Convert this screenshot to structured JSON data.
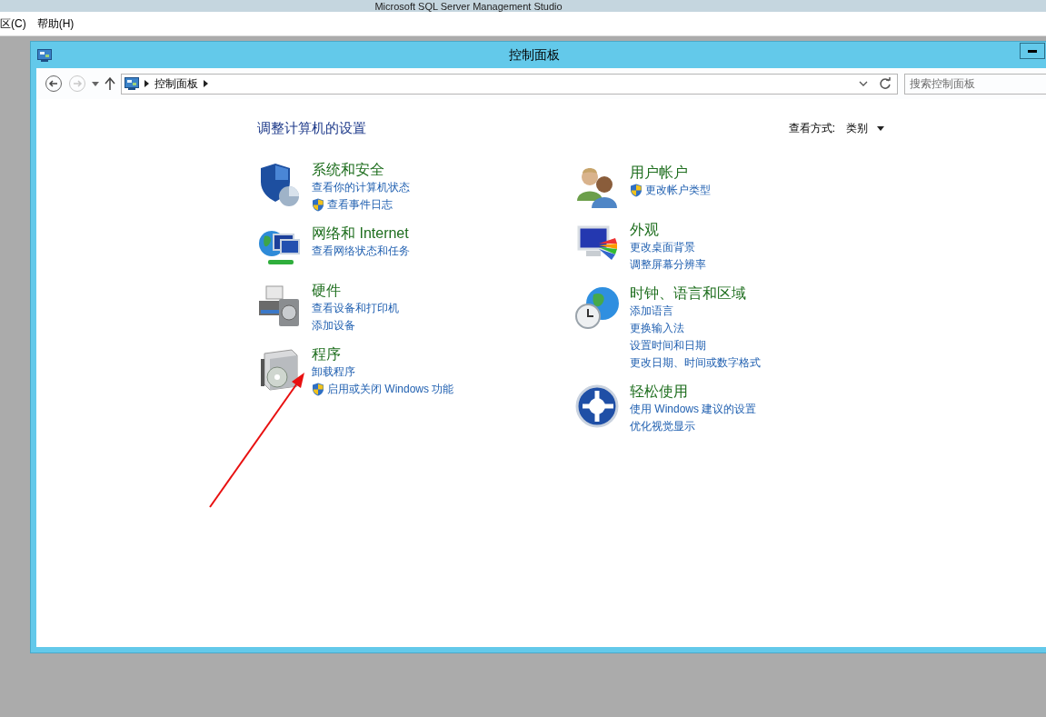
{
  "parent_window": {
    "title": "Microsoft SQL Server Management Studio",
    "menu": [
      "区(C)",
      "帮助(H)"
    ]
  },
  "window": {
    "title": "控制面板"
  },
  "address_bar": {
    "breadcrumb": [
      "控制面板"
    ],
    "search_placeholder": "搜索控制面板"
  },
  "heading": "调整计算机的设置",
  "view_by": {
    "label": "查看方式:",
    "value": "类别"
  },
  "columns": [
    [
      {
        "kind": "security",
        "title": "系统和安全",
        "links": [
          {
            "text": "查看你的计算机状态",
            "shield": false
          },
          {
            "text": "查看事件日志",
            "shield": true
          }
        ]
      },
      {
        "kind": "network",
        "title": "网络和 Internet",
        "links": [
          {
            "text": "查看网络状态和任务",
            "shield": false
          }
        ]
      },
      {
        "kind": "hardware",
        "title": "硬件",
        "links": [
          {
            "text": "查看设备和打印机",
            "shield": false
          },
          {
            "text": "添加设备",
            "shield": false
          }
        ]
      },
      {
        "kind": "programs",
        "title": "程序",
        "links": [
          {
            "text": "卸载程序",
            "shield": false
          },
          {
            "text": "启用或关闭 Windows 功能",
            "shield": true
          }
        ]
      }
    ],
    [
      {
        "kind": "users",
        "title": "用户帐户",
        "links": [
          {
            "text": "更改帐户类型",
            "shield": true
          }
        ]
      },
      {
        "kind": "appearance",
        "title": "外观",
        "links": [
          {
            "text": "更改桌面背景",
            "shield": false
          },
          {
            "text": "调整屏幕分辨率",
            "shield": false
          }
        ]
      },
      {
        "kind": "clock",
        "title": "时钟、语言和区域",
        "links": [
          {
            "text": "添加语言",
            "shield": false
          },
          {
            "text": "更换输入法",
            "shield": false
          },
          {
            "text": "设置时间和日期",
            "shield": false
          },
          {
            "text": "更改日期、时间或数字格式",
            "shield": false
          }
        ]
      },
      {
        "kind": "ease",
        "title": "轻松使用",
        "links": [
          {
            "text": "使用 Windows 建议的设置",
            "shield": false
          },
          {
            "text": "优化视觉显示",
            "shield": false
          }
        ]
      }
    ]
  ]
}
